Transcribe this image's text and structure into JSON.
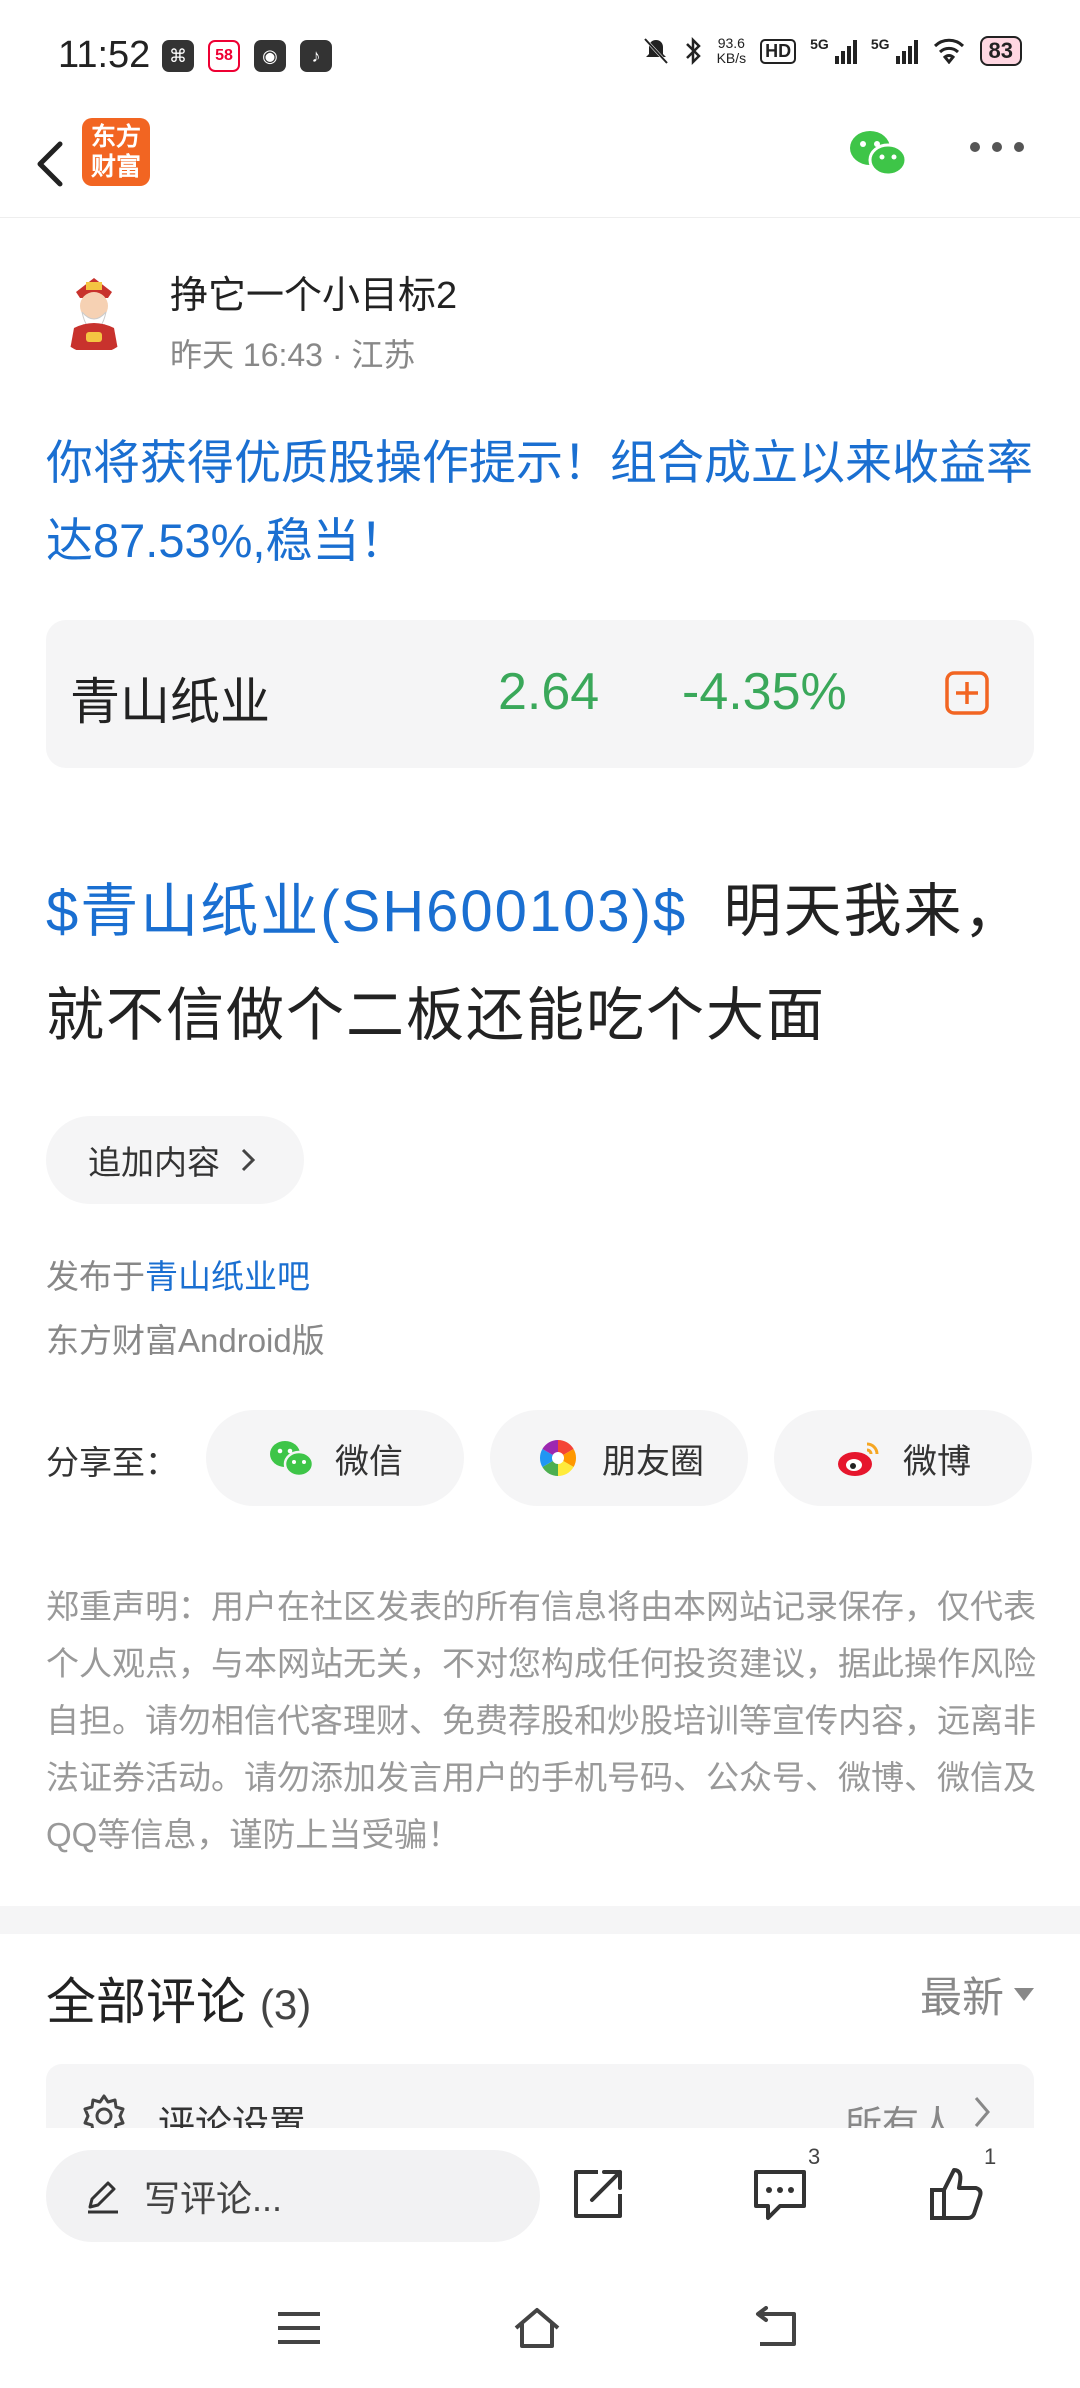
{
  "status_bar": {
    "time": "11:52",
    "network_speed_value": "93.6",
    "network_speed_unit": "KB/s",
    "hd_label": "HD",
    "signal_1_label": "5G",
    "signal_2_label": "5G",
    "battery": "83"
  },
  "header": {
    "logo_text_line1": "东方",
    "logo_text_line2": "财富"
  },
  "author": {
    "name": "挣它一个小目标2",
    "meta": "昨天 16:43 · 江苏"
  },
  "promo": {
    "text": "你将获得优质股操作提示！组合成立以来收益率达87.53%,稳当！"
  },
  "stock_card": {
    "name": "青山纸业",
    "price": "2.64",
    "change": "-4.35%",
    "color": "#3aa85a"
  },
  "post": {
    "stock_link": "$青山纸业(SH600103)$",
    "body": "明天我来，就不信做个二板还能吃个大面"
  },
  "append_button": {
    "label": "追加内容"
  },
  "published": {
    "prefix": "发布于",
    "bar_name": "青山纸业吧",
    "client": "东方财富Android版"
  },
  "share": {
    "label": "分享至：",
    "wechat": "微信",
    "moments": "朋友圈",
    "weibo": "微博"
  },
  "disclaimer": "郑重声明：用户在社区发表的所有信息将由本网站记录保存，仅代表个人观点，与本网站无关，不对您构成任何投资建议，据此操作风险自担。请勿相信代客理财、免费荐股和炒股培训等宣传内容，远离非法证券活动。请勿添加发言用户的手机号码、公众号、微博、微信及QQ等信息，谨防上当受骗！",
  "comments": {
    "title": "全部评论",
    "count": "(3)",
    "sort_label": "最新",
    "settings_label": "评论设置",
    "settings_value": "所有人"
  },
  "bottom_bar": {
    "input_placeholder": "写评论...",
    "comment_badge": "3",
    "like_badge": "1"
  },
  "colors": {
    "accent_blue": "#1a6fd1",
    "brand_orange": "#f26522",
    "down_green": "#3aa85a"
  }
}
